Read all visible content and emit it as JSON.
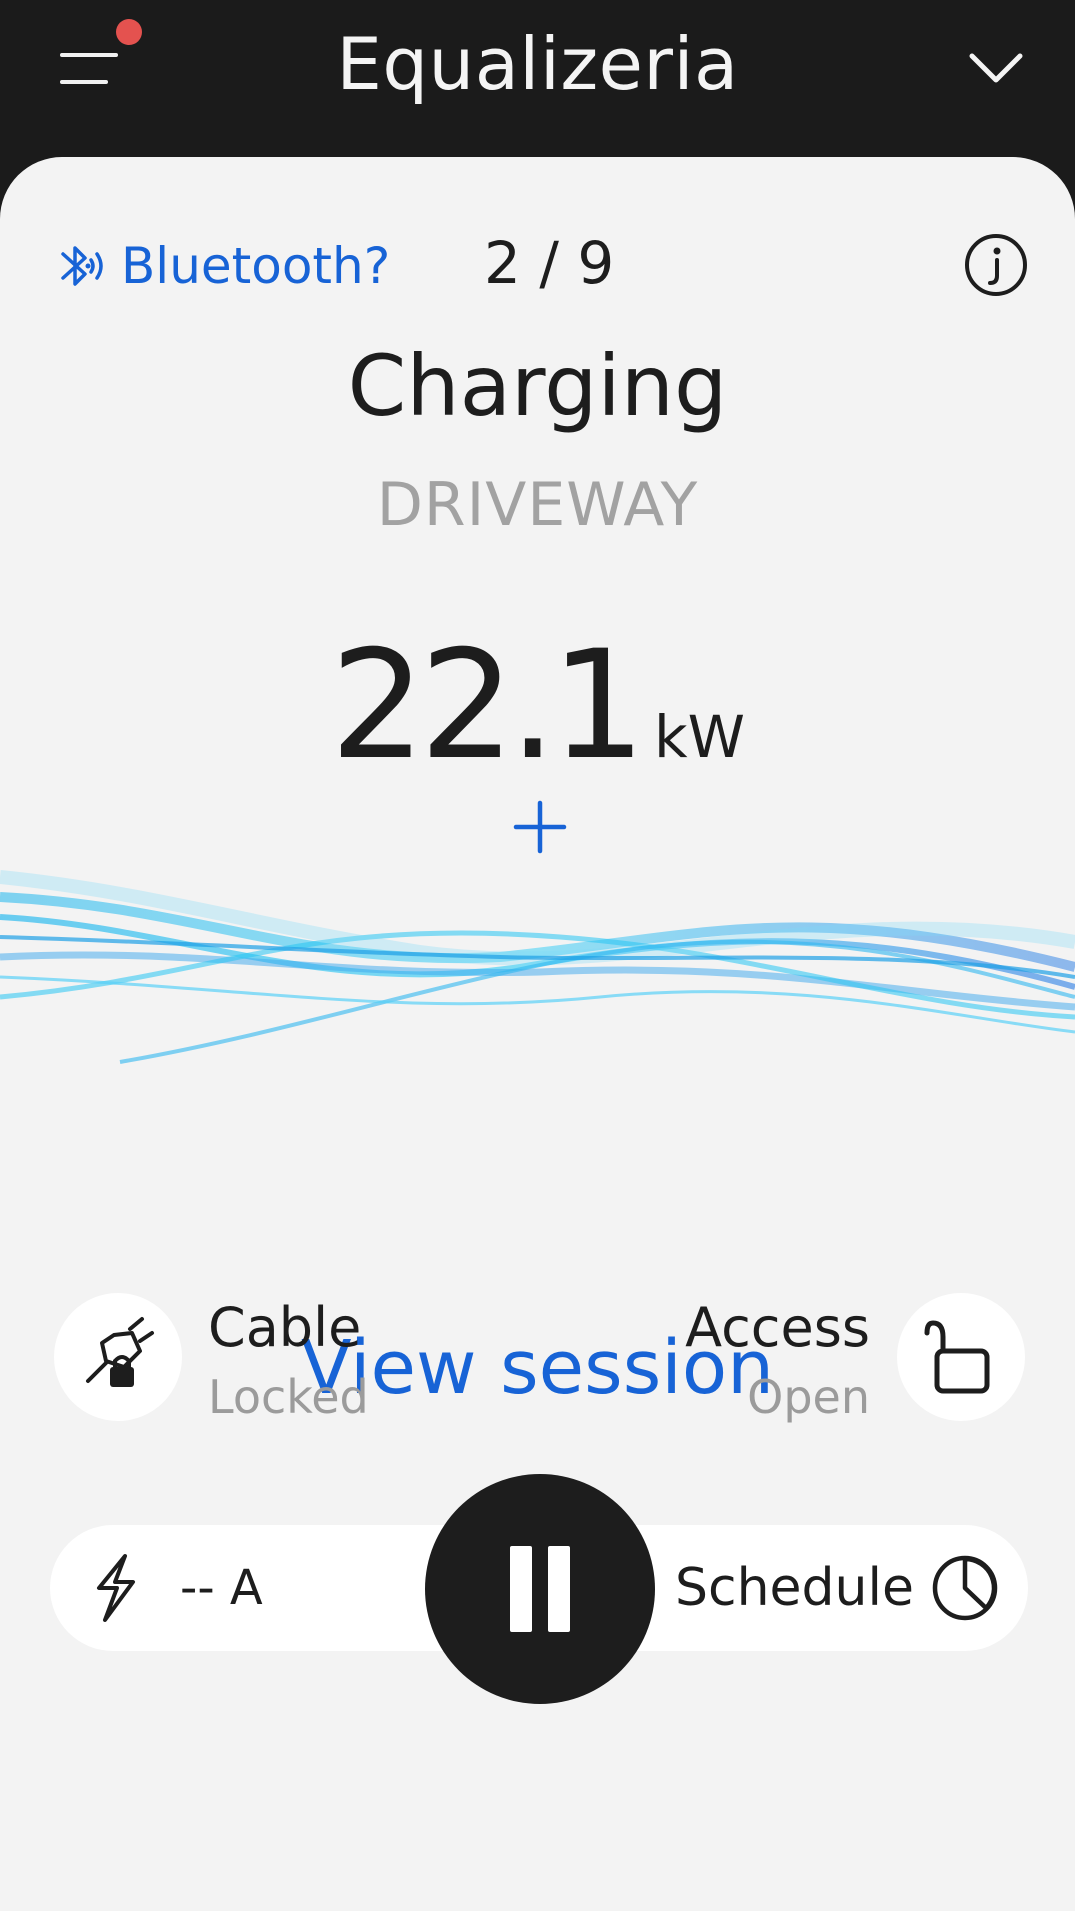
{
  "header": {
    "title": "Equalizeria",
    "menu_icon": "hamburger-menu-icon",
    "notification_color": "#e4524f",
    "dropdown_icon": "chevron-down-icon"
  },
  "device": {
    "bluetooth_label": "Bluetooth?",
    "counter": "2 / 9",
    "info_icon": "info-icon"
  },
  "charger": {
    "status": "Charging",
    "location": "DRIVEWAY",
    "power_value": "22.1",
    "power_unit": "kW",
    "increase_icon": "plus-icon"
  },
  "session": {
    "view_session_label": "View session"
  },
  "cable": {
    "label": "Cable",
    "state": "Locked",
    "icon": "plug-lock-icon"
  },
  "access": {
    "label": "Access",
    "state": "Open",
    "icon": "unlocked-padlock-icon"
  },
  "controls": {
    "current_label": "-- A",
    "pause_icon": "pause-icon",
    "schedule_label": "Schedule",
    "schedule_icon": "clock-icon"
  },
  "colors": {
    "accent": "#1763d6",
    "background": "#f3f3f3",
    "header": "#1b1b1b"
  }
}
